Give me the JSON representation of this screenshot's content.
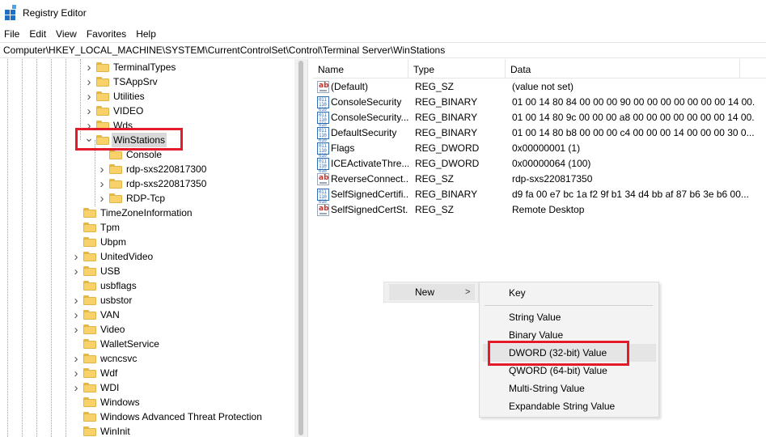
{
  "window": {
    "title": "Registry Editor"
  },
  "menubar": [
    "File",
    "Edit",
    "View",
    "Favorites",
    "Help"
  ],
  "address": "Computer\\HKEY_LOCAL_MACHINE\\SYSTEM\\CurrentControlSet\\Control\\Terminal Server\\WinStations",
  "tree": {
    "items": [
      {
        "label": "TerminalTypes",
        "chevron": ">"
      },
      {
        "label": "TSAppSrv",
        "chevron": ">"
      },
      {
        "label": "Utilities",
        "chevron": ">"
      },
      {
        "label": "VIDEO",
        "chevron": ">"
      },
      {
        "label": "Wds",
        "chevron": ">"
      },
      {
        "label": "WinStations",
        "chevron": "v",
        "selected": true
      },
      {
        "label": "Console",
        "chevron": ""
      },
      {
        "label": "rdp-sxs220817300",
        "chevron": ">"
      },
      {
        "label": "rdp-sxs220817350",
        "chevron": ">"
      },
      {
        "label": "RDP-Tcp",
        "chevron": ">"
      },
      {
        "label": "TimeZoneInformation",
        "chevron": ""
      },
      {
        "label": "Tpm",
        "chevron": ""
      },
      {
        "label": "Ubpm",
        "chevron": ""
      },
      {
        "label": "UnitedVideo",
        "chevron": ">"
      },
      {
        "label": "USB",
        "chevron": ">"
      },
      {
        "label": "usbflags",
        "chevron": ""
      },
      {
        "label": "usbstor",
        "chevron": ">"
      },
      {
        "label": "VAN",
        "chevron": ">"
      },
      {
        "label": "Video",
        "chevron": ">"
      },
      {
        "label": "WalletService",
        "chevron": ""
      },
      {
        "label": "wcncsvc",
        "chevron": ">"
      },
      {
        "label": "Wdf",
        "chevron": ">"
      },
      {
        "label": "WDI",
        "chevron": ">"
      },
      {
        "label": "Windows",
        "chevron": ""
      },
      {
        "label": "Windows Advanced Threat Protection",
        "chevron": ""
      },
      {
        "label": "WinInit",
        "chevron": ""
      }
    ]
  },
  "list": {
    "columns": [
      "Name",
      "Type",
      "Data"
    ],
    "rows": [
      {
        "icon": "string",
        "name": "(Default)",
        "type": "REG_SZ",
        "data": "(value not set)"
      },
      {
        "icon": "binary",
        "name": "ConsoleSecurity",
        "type": "REG_BINARY",
        "data": "01 00 14 80 84 00 00 00 90 00 00 00 00 00 00 00 14 00..."
      },
      {
        "icon": "binary",
        "name": "ConsoleSecurity...",
        "type": "REG_BINARY",
        "data": "01 00 14 80 9c 00 00 00 a8 00 00 00 00 00 00 00 14 00..."
      },
      {
        "icon": "binary",
        "name": "DefaultSecurity",
        "type": "REG_BINARY",
        "data": "01 00 14 80 b8 00 00 00 c4 00 00 00 14 00 00 00 30 0..."
      },
      {
        "icon": "binary",
        "name": "Flags",
        "type": "REG_DWORD",
        "data": "0x00000001 (1)"
      },
      {
        "icon": "binary",
        "name": "ICEActivateThre...",
        "type": "REG_DWORD",
        "data": "0x00000064 (100)"
      },
      {
        "icon": "string",
        "name": "ReverseConnect...",
        "type": "REG_SZ",
        "data": "rdp-sxs220817350"
      },
      {
        "icon": "binary",
        "name": "SelfSignedCertifi...",
        "type": "REG_BINARY",
        "data": "d9 fa 00 e7 bc 1a f2 9f b1 34 d4 bb af 87 b6 3e b6 00..."
      },
      {
        "icon": "string",
        "name": "SelfSignedCertSt...",
        "type": "REG_SZ",
        "data": "Remote Desktop"
      }
    ]
  },
  "context_menu": {
    "new_label": "New",
    "arrow": ">",
    "submenu": [
      "Key",
      "String Value",
      "Binary Value",
      "DWORD (32-bit) Value",
      "QWORD (64-bit) Value",
      "Multi-String Value",
      "Expandable String Value"
    ],
    "highlighted": "DWORD (32-bit) Value"
  },
  "colors": {
    "highlight_box": "#e31b2a",
    "folder": "#f8d16b",
    "selection": "#d9d9d9"
  }
}
